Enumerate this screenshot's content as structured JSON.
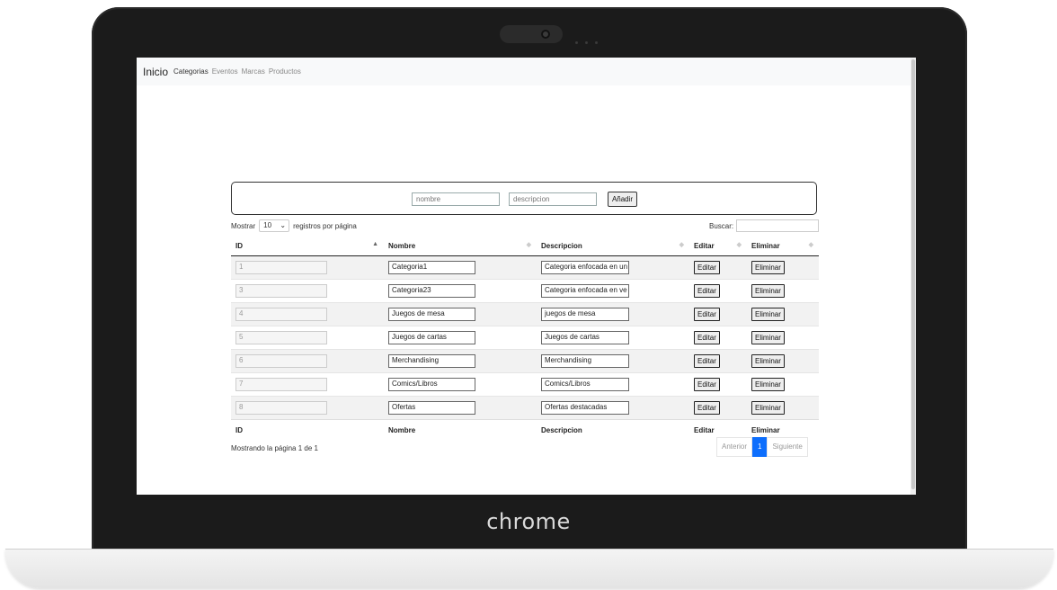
{
  "device": {
    "logo": "chrome"
  },
  "navbar": {
    "brand": "Inicio",
    "links": [
      "Categorias",
      "Eventos",
      "Marcas",
      "Productos"
    ]
  },
  "add_form": {
    "nombre_placeholder": "nombre",
    "descripcion_placeholder": "descripcion",
    "button": "Añadir"
  },
  "length": {
    "prefix": "Mostrar",
    "value": "10",
    "suffix": "registros por página"
  },
  "search": {
    "label": "Buscar:"
  },
  "table": {
    "columns": [
      "ID",
      "Nombre",
      "Descripcion",
      "Editar",
      "Eliminar"
    ],
    "edit_label": "Editar",
    "delete_label": "Eliminar",
    "rows": [
      {
        "id": "1",
        "nombre": "Categoria1",
        "descripcion": "Categoria enfocada en un"
      },
      {
        "id": "3",
        "nombre": "Categoria23",
        "descripcion": "Categoria enfocada en ve"
      },
      {
        "id": "4",
        "nombre": "Juegos de mesa",
        "descripcion": "juegos de mesa"
      },
      {
        "id": "5",
        "nombre": "Juegos de cartas",
        "descripcion": "Juegos de cartas"
      },
      {
        "id": "6",
        "nombre": "Merchandising",
        "descripcion": "Merchandising"
      },
      {
        "id": "7",
        "nombre": "Comics/Libros",
        "descripcion": "Comics/Libros"
      },
      {
        "id": "8",
        "nombre": "Ofertas",
        "descripcion": "Ofertas destacadas"
      }
    ]
  },
  "footer": {
    "info": "Mostrando la página 1 de 1",
    "prev": "Anterior",
    "page": "1",
    "next": "Siguiente"
  }
}
